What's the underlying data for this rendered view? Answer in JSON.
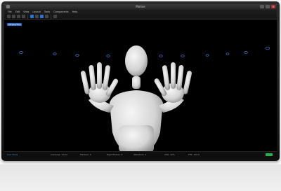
{
  "window": {
    "title": "Motive",
    "controls": [
      "minimize",
      "maximize",
      "close"
    ],
    "close_symbol": "×"
  },
  "menu": {
    "items": [
      "File",
      "Edit",
      "View",
      "Layout",
      "Tools",
      "Components",
      "Help"
    ]
  },
  "toolbar": {
    "tools": [
      "select-icon",
      "move-icon",
      "rotate-icon",
      "scale-icon",
      "camera-icon",
      "marker-icon",
      "skeleton-icon",
      "rigidbody-icon",
      "view-icon"
    ]
  },
  "viewport": {
    "view_label": "Perspective",
    "light_count": 10
  },
  "status": {
    "items": [
      {
        "text": "Live Mode",
        "accent": true
      },
      {
        "text": "Cameras: 12/12"
      },
      {
        "text": "Markers: 0"
      },
      {
        "text": "Rigid Bodies: 0"
      },
      {
        "text": "Skeletons: 1"
      },
      {
        "text": "CPU: 12%"
      },
      {
        "text": "FPS: 120.0"
      }
    ]
  },
  "colors": {
    "accent": "#2e6fd0",
    "status_ok": "#1db24a",
    "viewport_bg": "#000000",
    "model": "#dcdcdc"
  }
}
